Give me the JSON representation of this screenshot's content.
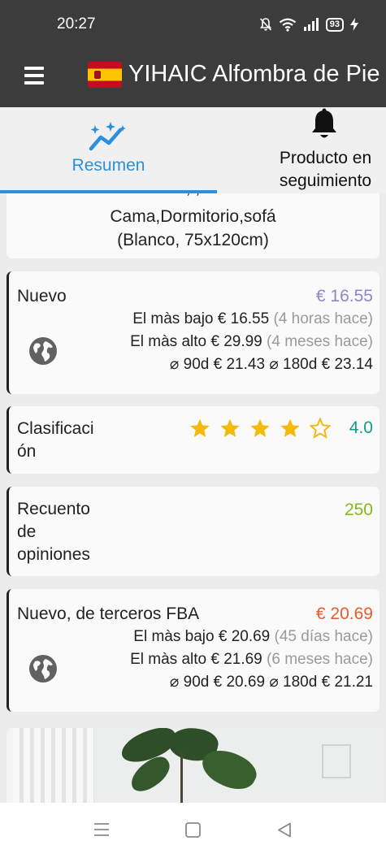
{
  "status_bar": {
    "time": "20:27",
    "battery": "93"
  },
  "app_bar": {
    "title": "YIHAIC Alfombra de Pie"
  },
  "tabs": [
    {
      "label": "Resumen",
      "icon": "trend-sparkle-icon",
      "active": true
    },
    {
      "label_line1": "Producto en",
      "label_line2": "seguimiento",
      "icon": "bell-icon",
      "active": false
    }
  ],
  "product_title": {
    "partial_line": ", ,",
    "line1": "Cama,Dormitorio,sofá",
    "line2": "(Blanco, 75x120cm)"
  },
  "nuevo": {
    "label": "Nuevo",
    "price": "€ 16.55",
    "low_label": "El màs bajo",
    "low_price": "€ 16.55",
    "low_when": "(4 horas hace)",
    "high_label": "El màs alto",
    "high_price": "€ 29.99",
    "high_when": "(4 meses hace)",
    "avg90_label": "⌀ 90d",
    "avg90_price": "€ 21.43",
    "avg180_label": "⌀ 180d",
    "avg180_price": "€ 23.14",
    "accent": "#8e86c9"
  },
  "clasificacion": {
    "label_line1": "Clasificaci",
    "label_line2": "ón",
    "rating": "4.0",
    "stars_filled": 4,
    "stars_total": 5,
    "accent": "#159a89",
    "star_color": "#f2b90f"
  },
  "recuento": {
    "label_line1": "Recuento",
    "label_line2": "de",
    "label_line3": "opiniones",
    "count": "250",
    "accent": "#86b81f"
  },
  "fba": {
    "label": "Nuevo, de terceros FBA",
    "price": "€ 20.69",
    "low_label": "El màs bajo",
    "low_price": "€ 20.69",
    "low_when": "(45 días hace)",
    "high_label": "El màs alto",
    "high_price": "€ 21.69",
    "high_when": "(6 meses hace)",
    "avg90_label": "⌀ 90d",
    "avg90_price": "€ 20.69",
    "avg180_label": "⌀ 180d",
    "avg180_price": "€ 21.21",
    "accent": "#e85b2f"
  },
  "colors": {
    "bar_bg": "#3c3c3c",
    "tab_active": "#2a8fde",
    "page_bg": "#ececec",
    "card_bg": "#fafafa"
  }
}
